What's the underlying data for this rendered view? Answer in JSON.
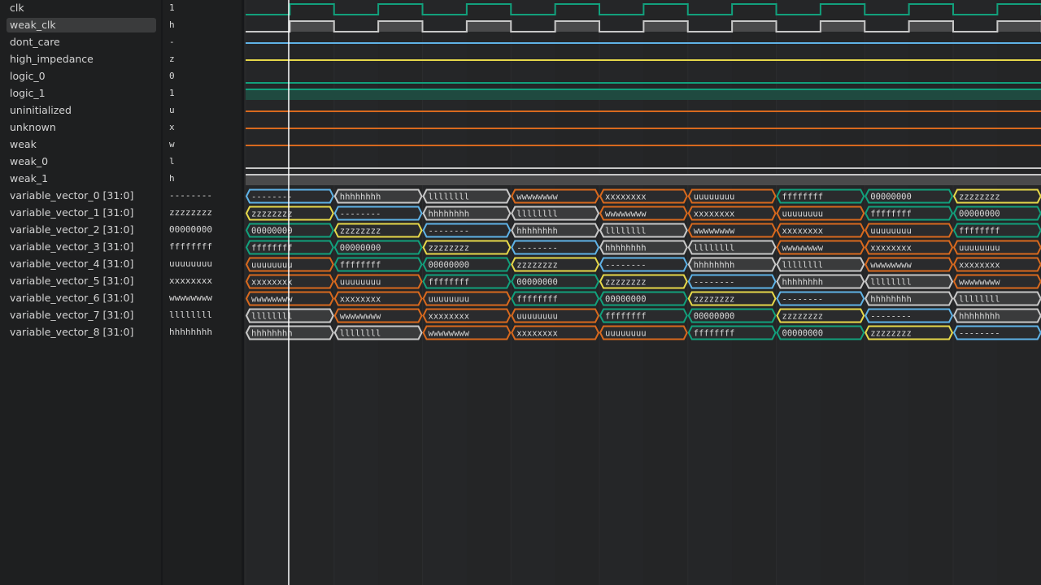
{
  "signals": [
    {
      "name": "clk",
      "value": "1"
    },
    {
      "name": "weak_clk",
      "value": "h",
      "selected": true
    },
    {
      "name": "dont_care",
      "value": "-"
    },
    {
      "name": "high_impedance",
      "value": "z"
    },
    {
      "name": "logic_0",
      "value": "0"
    },
    {
      "name": "logic_1",
      "value": "1"
    },
    {
      "name": "uninitialized",
      "value": "u"
    },
    {
      "name": "unknown",
      "value": "x"
    },
    {
      "name": "weak",
      "value": "w"
    },
    {
      "name": "weak_0",
      "value": "l"
    },
    {
      "name": "weak_1",
      "value": "h"
    },
    {
      "name": "variable_vector_0 [31:0]",
      "value": "--------"
    },
    {
      "name": "variable_vector_1 [31:0]",
      "value": "zzzzzzzz"
    },
    {
      "name": "variable_vector_2 [31:0]",
      "value": "00000000"
    },
    {
      "name": "variable_vector_3 [31:0]",
      "value": "ffffffff"
    },
    {
      "name": "variable_vector_4 [31:0]",
      "value": "uuuuuuuu"
    },
    {
      "name": "variable_vector_5 [31:0]",
      "value": "xxxxxxxx"
    },
    {
      "name": "variable_vector_6 [31:0]",
      "value": "wwwwwwww"
    },
    {
      "name": "variable_vector_7 [31:0]",
      "value": "llllllll"
    },
    {
      "name": "variable_vector_8 [31:0]",
      "value": "hhhhhhhh"
    }
  ],
  "vector_cycle": [
    "--------",
    "hhhhhhhh",
    "llllllll",
    "wwwwwwww",
    "xxxxxxxx",
    "uuuuuuuu",
    "ffffffff",
    "00000000",
    "zzzzzzzz"
  ],
  "colors": {
    "green": "#12a07c",
    "white": "#c8c8c8",
    "blue": "#5fb2e6",
    "yellow": "#e6d84a",
    "orange": "#d8691e",
    "cursor": "#ffffff"
  }
}
